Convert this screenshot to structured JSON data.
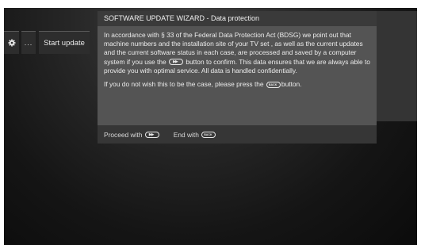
{
  "toolbar": {
    "settings_icon": "gear-icon",
    "more_label": "...",
    "start_update_label": "Start update"
  },
  "wizard": {
    "title": "SOFTWARE UPDATE WIZARD - Data protection",
    "paragraph1_part1": "In accordance with § 33 of the Federal Data Protection Act (BDSG) we point out that machine numbers and the installation site of your TV set , as well as the current updates and the current software status in each case, are processed and saved by a computer system if you use the",
    "paragraph1_part2": "button to confirm. This data ensures that we are always able to provide you with optimal service. All data is handled confidentially.",
    "paragraph2_part1": "If you do not wish this to be the case, please press the",
    "paragraph2_part2": "button.",
    "footer": {
      "proceed_label": "Proceed with",
      "end_label": "End with"
    },
    "keys": {
      "forward_key_icon": "fast-forward-key-icon",
      "forward_key_glyph": "▶▶",
      "back_key_icon": "back-key-icon",
      "back_key_glyph": "BACK"
    }
  },
  "colors": {
    "title_bar": "#3a3a3a",
    "body": "#545454",
    "footer": "#363636",
    "text": "#ececec"
  }
}
